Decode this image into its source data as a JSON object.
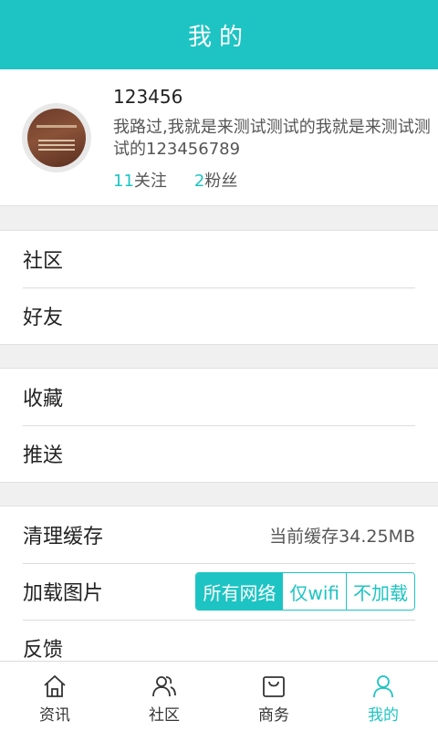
{
  "header": {
    "title": "我的"
  },
  "profile": {
    "username": "123456",
    "signature": "我路过,我就是来测试测试的我就是来测试测试的123456789",
    "following_count": "11",
    "following_label": "关注",
    "fans_count": "2",
    "fans_label": "粉丝"
  },
  "menu": {
    "community": "社区",
    "friends": "好友",
    "favorites": "收藏",
    "push": "推送",
    "clear_cache": "清理缓存",
    "cache_info": "当前缓存34.25MB",
    "load_images": "加载图片",
    "image_options": [
      "所有网络",
      "仅wifi",
      "不加载"
    ],
    "image_selected": "所有网络",
    "feedback": "反馈"
  },
  "tabbar": {
    "items": [
      {
        "label": "资讯",
        "icon": "home-icon"
      },
      {
        "label": "社区",
        "icon": "people-icon"
      },
      {
        "label": "商务",
        "icon": "bag-icon"
      },
      {
        "label": "我的",
        "icon": "person-icon"
      }
    ],
    "active": "我的"
  },
  "colors": {
    "accent": "#1dc4c3"
  }
}
